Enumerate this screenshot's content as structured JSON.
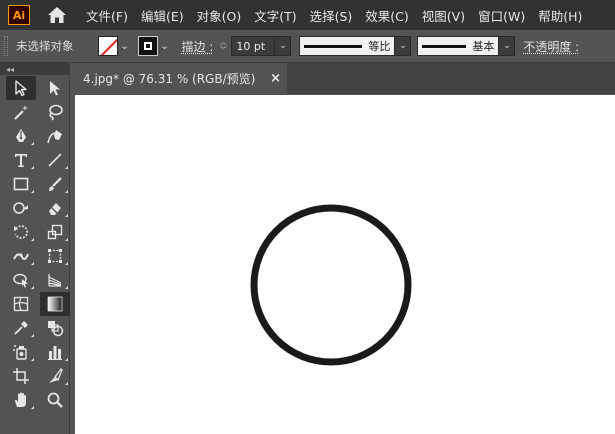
{
  "app": {
    "logo_text": "Ai",
    "menus": [
      "文件(F)",
      "编辑(E)",
      "对象(O)",
      "文字(T)",
      "选择(S)",
      "效果(C)",
      "视图(V)",
      "窗口(W)",
      "帮助(H)"
    ]
  },
  "control_bar": {
    "selection_status": "未选择对象",
    "stroke_label": "描边 :",
    "stroke_weight": "10 pt",
    "variable_width": "等比",
    "brush_definition": "基本",
    "opacity_label": "不透明度 :"
  },
  "document": {
    "tab_title": "4.jpg* @ 76.31 % (RGB/预览)",
    "close_symbol": "×"
  },
  "toolbar": {
    "collapse_symbol": "◂◂"
  },
  "circle": {
    "stroke_color": "#1a1a1a"
  },
  "colors": {
    "menubar_bg": "#323232",
    "panel_bg": "#535353",
    "canvas_bg": "#ffffff",
    "no_fill_slash": "#e0201a",
    "logo_accent": "#ff9a00"
  }
}
